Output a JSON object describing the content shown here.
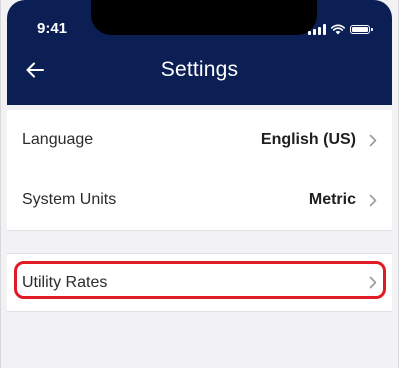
{
  "status_bar": {
    "time": "9:41",
    "icons": [
      "signal-icon",
      "wifi-icon",
      "battery-icon"
    ]
  },
  "header": {
    "title": "Settings",
    "back_icon": "back-arrow-icon",
    "background_color": "#0b1f54"
  },
  "settings": {
    "general": [
      {
        "label": "Language",
        "value": "English (US)"
      },
      {
        "label": "System Units",
        "value": "Metric"
      }
    ],
    "utility": {
      "label": "Utility Rates"
    }
  },
  "annotation": {
    "highlight_color": "#e01b24",
    "target": "Utility Rates"
  }
}
